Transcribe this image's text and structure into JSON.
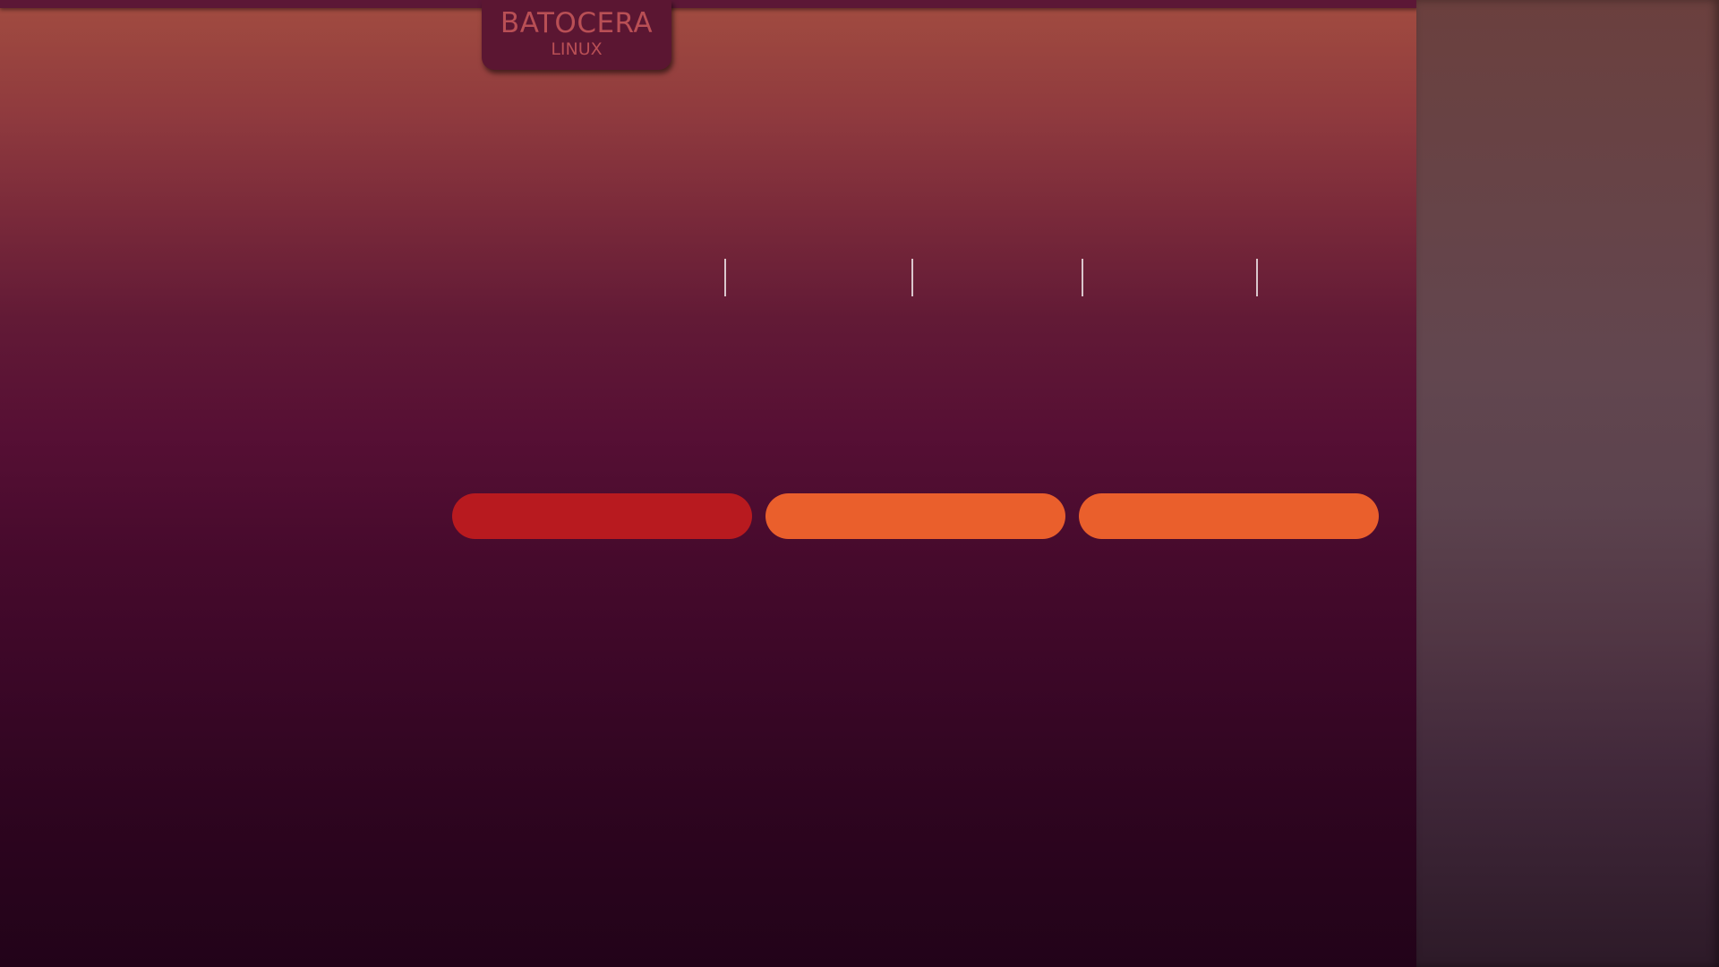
{
  "logo": {
    "main_text": "BATOCERA",
    "sub_text": "LINUX",
    "tab_color": "#5b1632",
    "text_color": "#b94f55"
  },
  "background": {
    "top_color": "#a24c40",
    "bottom_color": "#220319",
    "side_panel_color": "#62464f"
  },
  "buttons": [
    {
      "color": "#b81a1f",
      "selected": true
    },
    {
      "color": "#ea5f2c",
      "selected": false
    },
    {
      "color": "#ea5f2c",
      "selected": false
    }
  ]
}
